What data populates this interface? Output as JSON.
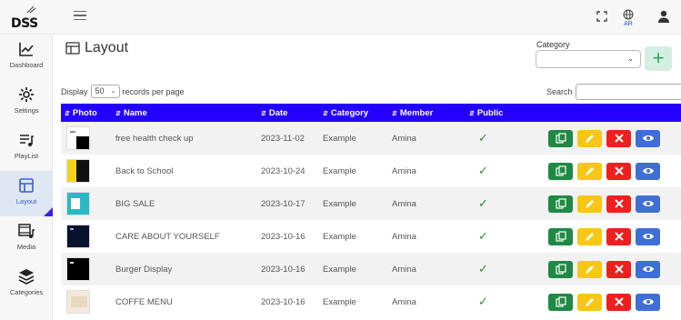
{
  "app": {
    "logo_text": "DSS"
  },
  "topbar": {
    "lang_code": "AR"
  },
  "sidebar": {
    "items": [
      {
        "label": "Dashboard",
        "icon": "chart-line-icon"
      },
      {
        "label": "Settings",
        "icon": "gear-icon"
      },
      {
        "label": "PlayList",
        "icon": "playlist-icon"
      },
      {
        "label": "Layout",
        "icon": "layout-icon",
        "active": true
      },
      {
        "label": "Media",
        "icon": "media-icon"
      },
      {
        "label": "Categories",
        "icon": "stack-icon"
      }
    ]
  },
  "page": {
    "title": "Layout"
  },
  "category_filter": {
    "label": "Category",
    "value": ""
  },
  "add_button": {
    "label": "+"
  },
  "display": {
    "prefix": "Display",
    "value": "50",
    "suffix": "records per page"
  },
  "search": {
    "label": "Search",
    "value": ""
  },
  "table": {
    "columns": [
      "Photo",
      "Name",
      "Date",
      "Category",
      "Member",
      "Public"
    ],
    "rows": [
      {
        "name": "free health check up",
        "date": "2023-11-02",
        "category": "Example",
        "member": "Amina",
        "public": "✓",
        "thumb": "white-dark"
      },
      {
        "name": "Back to School",
        "date": "2023-10-24",
        "category": "Example",
        "member": "Amina",
        "public": "✓",
        "thumb": "yellow-dark"
      },
      {
        "name": "BIG SALE",
        "date": "2023-10-17",
        "category": "Example",
        "member": "Amina",
        "public": "✓",
        "thumb": "teal"
      },
      {
        "name": "CARE ABOUT YOURSELF",
        "date": "2023-10-16",
        "category": "Example",
        "member": "Amina",
        "public": "✓",
        "thumb": "dark-blue"
      },
      {
        "name": "Burger Display",
        "date": "2023-10-16",
        "category": "Example",
        "member": "Amina",
        "public": "✓",
        "thumb": "black"
      },
      {
        "name": "COFFE MENU",
        "date": "2023-10-16",
        "category": "Example",
        "member": "Amina",
        "public": "✓",
        "thumb": "beige"
      }
    ]
  },
  "colors": {
    "header": "#2400ff",
    "copy": "#1e8a43",
    "edit": "#f8c615",
    "delete": "#ef1f1f",
    "view": "#3f6fd6",
    "public_check": "#2e8b3a"
  }
}
